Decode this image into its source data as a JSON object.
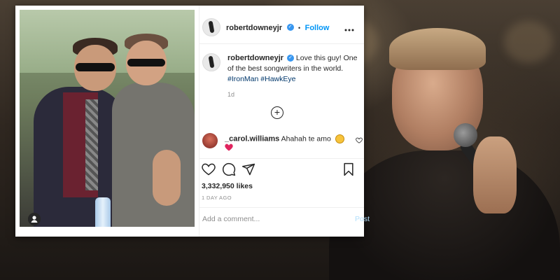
{
  "post": {
    "username": "robertdowneyjr",
    "verified_glyph": "✓",
    "separator": "•",
    "follow_label": "Follow",
    "more_label": "•••",
    "caption": {
      "username": "robertdowneyjr",
      "text": "Love this guy! One of the best songwriters in the world.",
      "hashtags": [
        "#IronMan",
        "#HawkEye"
      ]
    },
    "caption_time": "1d",
    "load_more_symbol": "+",
    "comment": {
      "username": "_carol.williams",
      "text": "Ahahah te amo"
    },
    "likes": "3,332,950 likes",
    "age": "1 DAY AGO",
    "comment_placeholder": "Add a comment...",
    "post_label": "Post"
  },
  "icons": {
    "like": "heart-icon",
    "comment": "comment-bubble-icon",
    "share": "paper-plane-icon",
    "save": "bookmark-icon",
    "user_tag": "user-icon"
  },
  "colors": {
    "follow": "#0095f6",
    "hashtag": "#00376b",
    "verified": "#3897f0",
    "heart": "#e0245e",
    "muted": "#8e8e8e"
  }
}
